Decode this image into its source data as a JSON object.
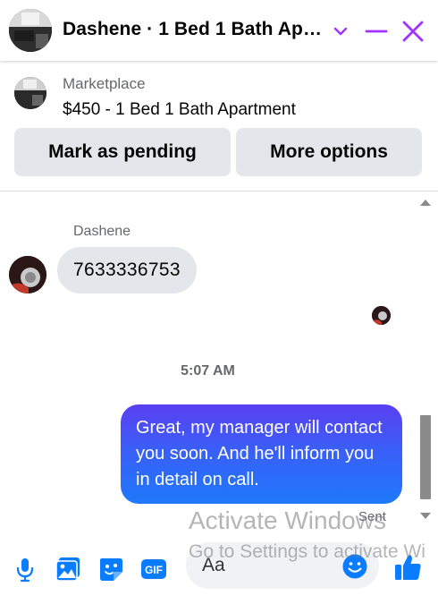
{
  "header": {
    "title": "Dashene · 1 Bed 1 Bath Ap…",
    "accent_color": "#a033ff"
  },
  "listing": {
    "source": "Marketplace",
    "title": "$450 - 1 Bed 1 Bath Apartment",
    "actions": [
      "Mark as pending",
      "More options"
    ]
  },
  "thread": {
    "sender_name": "Dashene",
    "incoming_message": "7633336753",
    "timestamp": "5:07 AM",
    "outgoing_message": "Great, my manager will contact you soon. And he'll inform you in detail on call.",
    "status": "Sent"
  },
  "watermark": {
    "line1": "Activate Windows",
    "line2": "Go to Settings to activate Wi"
  },
  "composer": {
    "placeholder": "Aa",
    "tools": [
      "mic-icon",
      "photo-icon",
      "sticker-icon",
      "gif-icon"
    ],
    "gif_label": "GIF",
    "brand_color": "#0a7cff"
  }
}
